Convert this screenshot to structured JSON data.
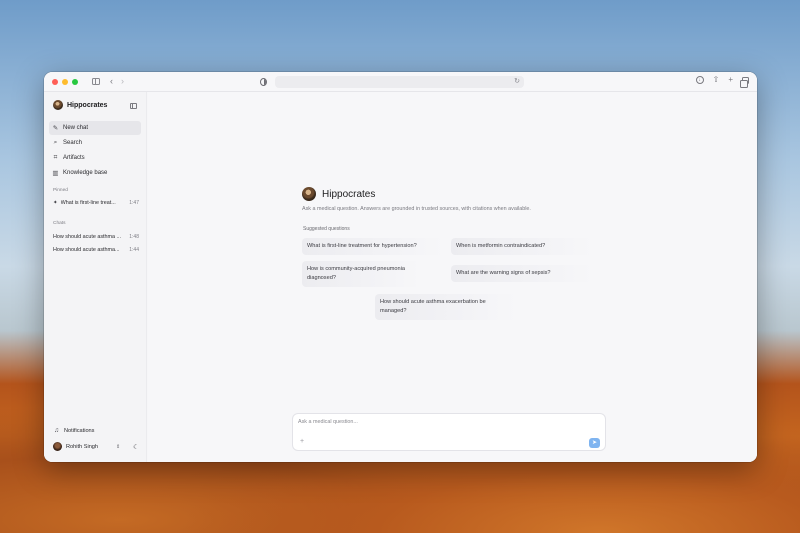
{
  "sidebar": {
    "brand": "Hippocrates",
    "nav": [
      {
        "label": "New chat",
        "icon": "✎",
        "icon_name": "compose-icon"
      },
      {
        "label": "Search",
        "icon": "⌕",
        "icon_name": "search-icon"
      },
      {
        "label": "Artifacts",
        "icon": "⌗",
        "icon_name": "artifacts-icon"
      },
      {
        "label": "Knowledge base",
        "icon": "▥",
        "icon_name": "library-icon"
      }
    ],
    "pinned_label": "Pinned",
    "pinned": [
      {
        "title": "What is first-line treat...",
        "time": "1:47"
      }
    ],
    "chats_label": "Chats",
    "chats": [
      {
        "title": "How should acute asthma ...",
        "time": "1:48"
      },
      {
        "title": "How should acute asthma...",
        "time": "1:44"
      }
    ],
    "notifications": "Notifications",
    "user": "Rohith Singh"
  },
  "main": {
    "title": "Hippocrates",
    "subtitle": "Ask a medical question. Answers are grounded in trusted sources, with citations when available.",
    "suggested_label": "Suggested questions",
    "suggestions": [
      "What is first-line treatment for hypertension?",
      "When is metformin contraindicated?",
      "How is community-acquired pneumonia diagnosed?",
      "What are the warning signs of sepsis?",
      "How should acute asthma exacerbation be managed?"
    ],
    "composer_placeholder": "Ask a medical question..."
  },
  "colors": {
    "accent": "#7fb4f0",
    "active_nav": "#e6e6ea"
  }
}
